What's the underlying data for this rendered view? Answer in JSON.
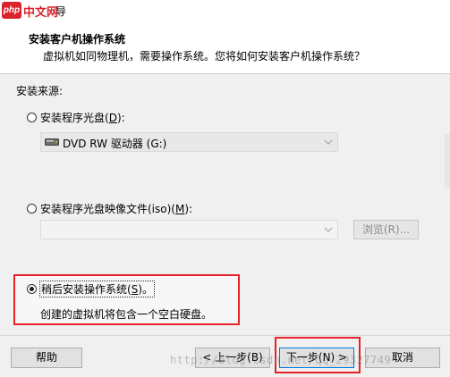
{
  "window": {
    "logo_php": "php",
    "logo_cn": "中文网",
    "title_visible": "导"
  },
  "header": {
    "title": "安装客户机操作系统",
    "subtitle": "虚拟机如同物理机，需要操作系统。您将如何安装客户机操作系统？"
  },
  "install_source": {
    "label": "安装来源:",
    "disc": {
      "label_pre": "安装程序光盘(",
      "accel": "D",
      "label_post": "):",
      "selected": false,
      "drive_value": "DVD RW 驱动器 (G:)"
    },
    "iso": {
      "label_pre": "安装程序光盘映像文件(iso)(",
      "accel": "M",
      "label_post": "):",
      "selected": false,
      "path_value": "",
      "browse_label": "浏览(R)..."
    },
    "later": {
      "label_pre": "稍后安装操作系统(",
      "accel": "S",
      "label_post": ")。",
      "selected": true,
      "description": "创建的虚拟机将包含一个空白硬盘。"
    }
  },
  "buttons": {
    "help": "帮助",
    "back": "< 上一步(B)",
    "next": "下一步(N) >",
    "cancel": "取消"
  },
  "watermark": "http://blog.csdn.net/qq_29327749",
  "colors": {
    "highlight": "#e52327",
    "logo_red": "#d9232e",
    "focus_border": "#0078d7"
  }
}
